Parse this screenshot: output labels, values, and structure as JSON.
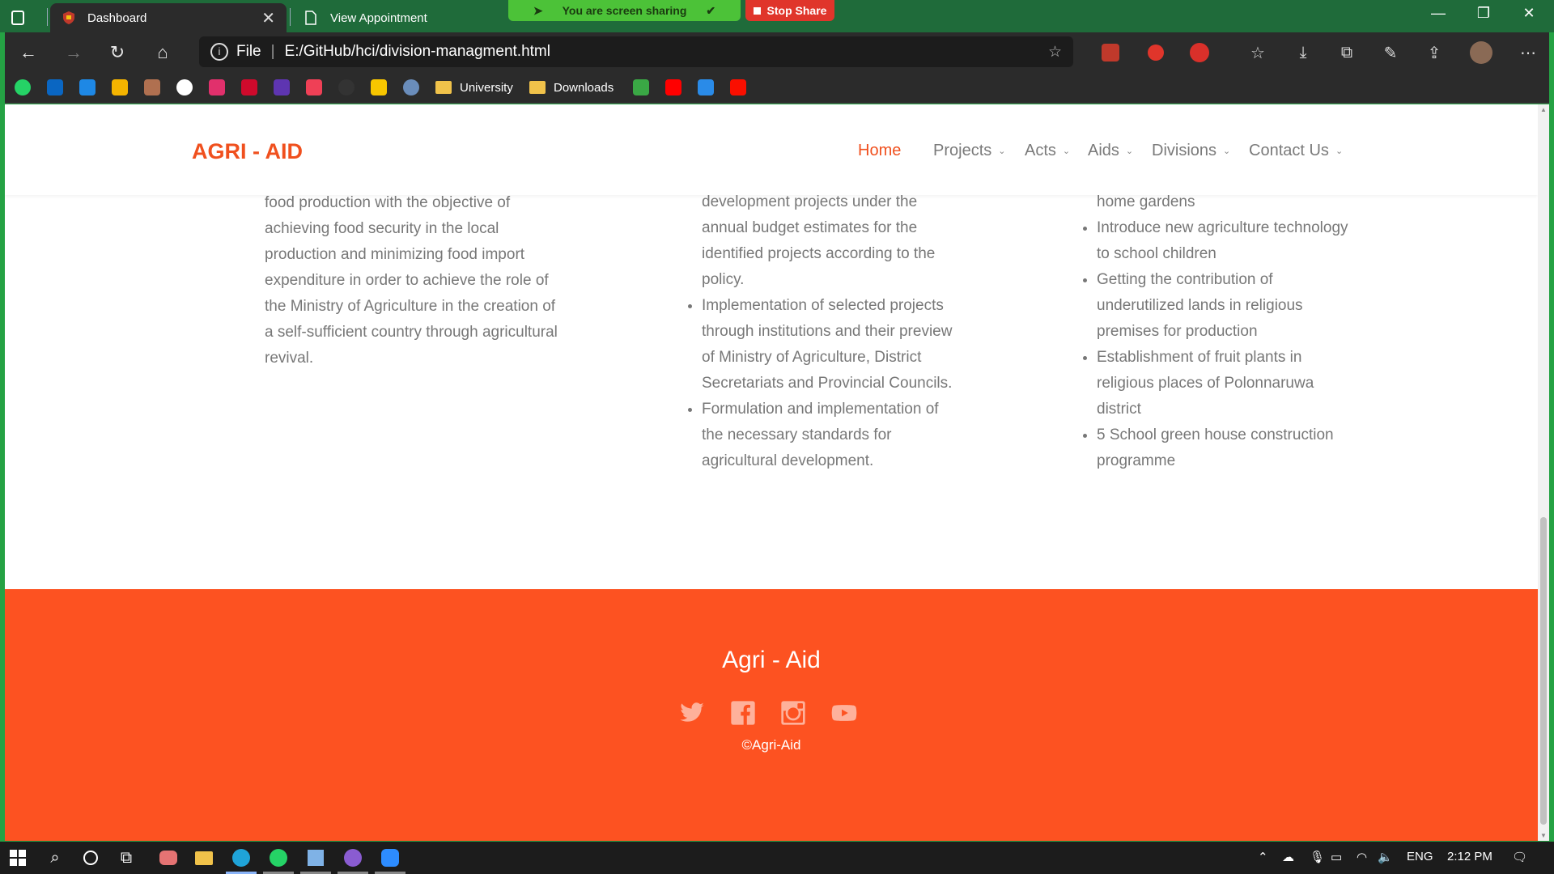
{
  "browser": {
    "tabs": [
      {
        "title": "Dashboard",
        "icon": "shield-icon"
      },
      {
        "title": "View Appointment",
        "icon": "page-icon"
      }
    ],
    "sharing_text": "You are screen sharing",
    "stop_share_label": "Stop Share",
    "address_prefix": "File",
    "address_url": "E:/GitHub/hci/division-managment.html",
    "bookmarks": [
      "University",
      "Downloads"
    ]
  },
  "site": {
    "logo": "AGRI - AID",
    "nav": [
      {
        "label": "Home",
        "active": true
      },
      {
        "label": "Projects"
      },
      {
        "label": "Acts"
      },
      {
        "label": "Aids"
      },
      {
        "label": "Divisions"
      },
      {
        "label": "Contact Us"
      }
    ],
    "col1_text": "food production with the objective of achieving food security in the local production and minimizing food import expenditure in order to achieve the role of the Ministry of Agriculture in the creation of a self-sufficient country through agricultural revival.",
    "col2_items": [
      "development projects under the annual budget estimates for the identified projects according to the policy.",
      "Implementation of selected projects through institutions and their preview of Ministry of Agriculture, District Secretariats and Provincial Councils.",
      "Formulation and implementation of the necessary standards for agricultural development."
    ],
    "col3_items": [
      "home gardens",
      "Introduce new agriculture technology to school children",
      "Getting the contribution of underutilized lands in religious premises for production",
      "Establishment of fruit plants in religious places of Polonnaruwa district",
      "5 School green house construction programme"
    ],
    "footer_title": "Agri - Aid",
    "copyright": "©Agri-Aid",
    "accent_color": "#fd5221"
  },
  "taskbar": {
    "lang": "ENG",
    "time": "2:12 PM"
  }
}
